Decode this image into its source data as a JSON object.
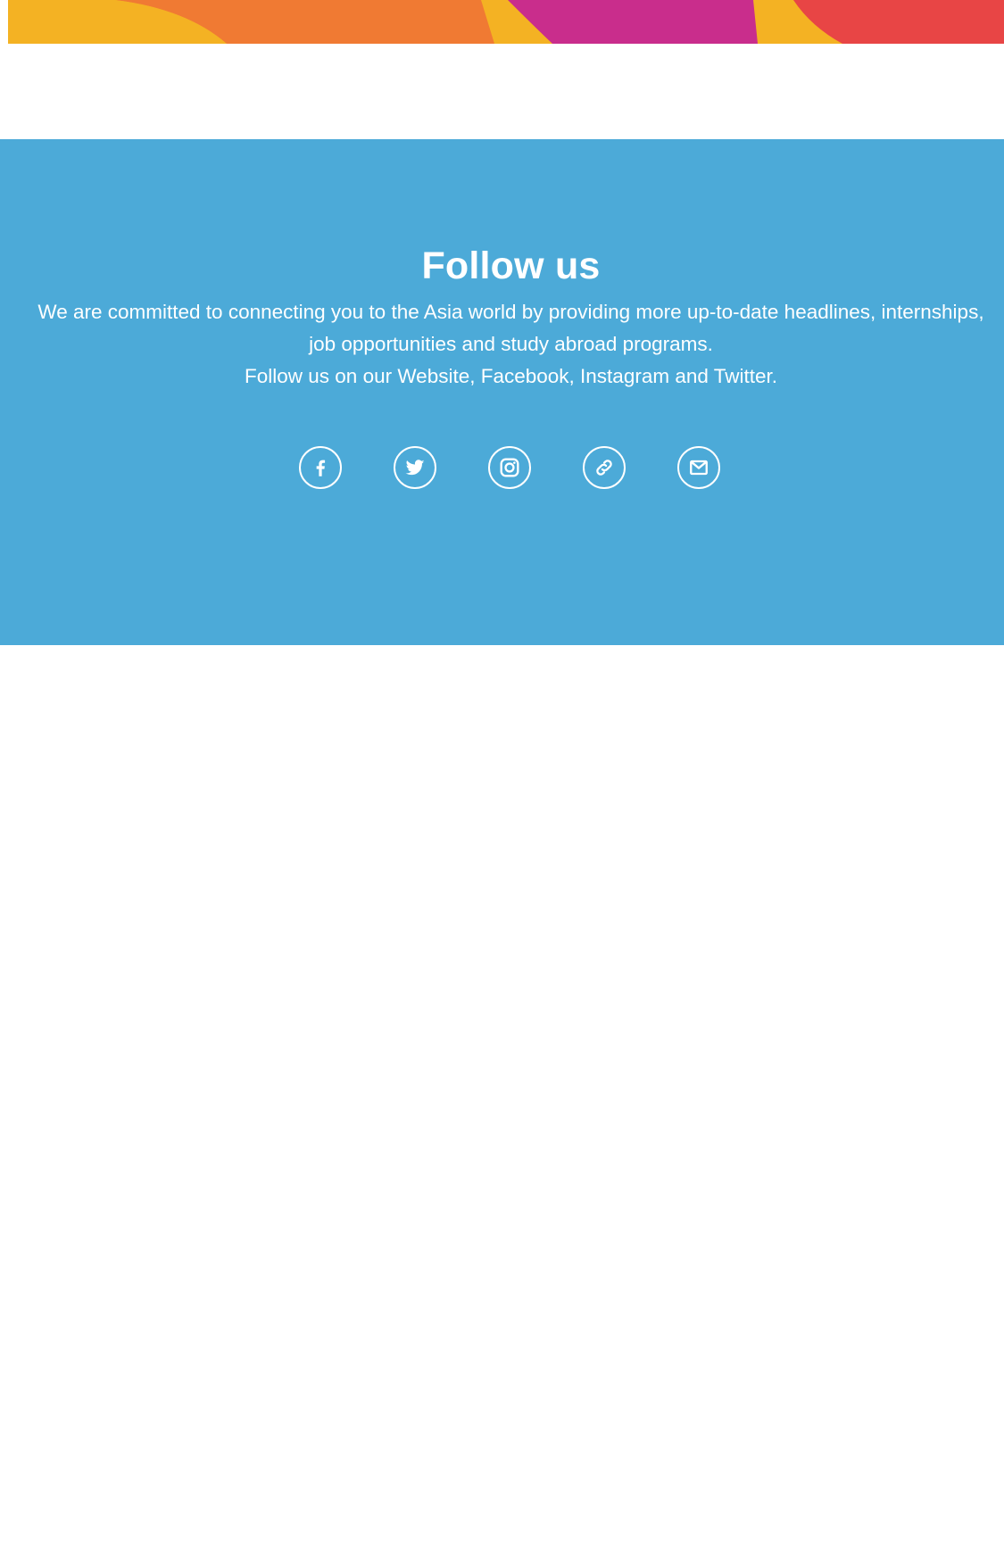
{
  "colors": {
    "section_bg": "#4caad8",
    "text": "#ffffff",
    "banner_yellow": "#f4b223",
    "banner_orange": "#f07a33",
    "banner_magenta": "#c92d8c",
    "banner_red": "#e84545"
  },
  "follow": {
    "title": "Follow us",
    "description_line1": "We are committed to connecting you to the Asia world by providing more up-to-date headlines, internships,",
    "description_line2": "job opportunities and study abroad programs.",
    "description_line3": "Follow us on our Website, Facebook, Instagram and Twitter."
  },
  "social_icons": [
    {
      "icon": "facebook-icon"
    },
    {
      "icon": "twitter-icon"
    },
    {
      "icon": "instagram-icon"
    },
    {
      "icon": "link-icon"
    },
    {
      "icon": "email-icon"
    }
  ]
}
